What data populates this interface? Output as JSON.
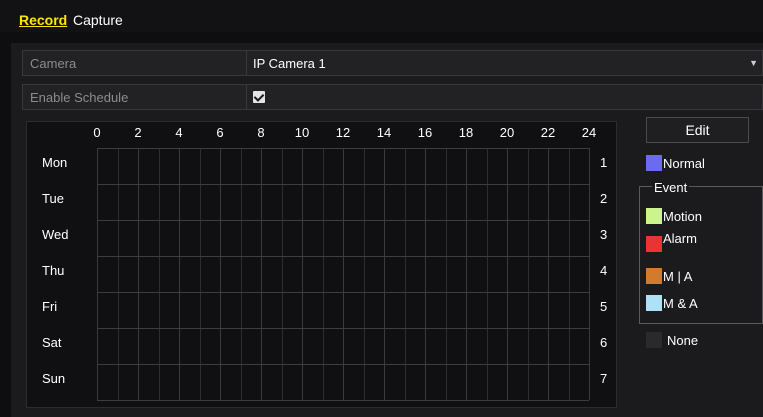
{
  "tabs": {
    "record": "Record",
    "capture": "Capture"
  },
  "camera": {
    "label": "Camera",
    "value": "IP Camera 1"
  },
  "enable_schedule": {
    "label": "Enable Schedule",
    "checked": true
  },
  "schedule": {
    "hours": [
      "0",
      "2",
      "4",
      "6",
      "8",
      "10",
      "12",
      "14",
      "16",
      "18",
      "20",
      "22",
      "24"
    ],
    "days": [
      "Mon",
      "Tue",
      "Wed",
      "Thu",
      "Fri",
      "Sat",
      "Sun"
    ],
    "copy_numbers": [
      "1",
      "2",
      "3",
      "4",
      "5",
      "6",
      "7"
    ]
  },
  "edit_button": "Edit",
  "legend": {
    "normal": {
      "label": "Normal",
      "color": "#6b6bf0"
    },
    "event_title": "Event",
    "motion": {
      "label": "Motion",
      "color": "#ccf48a"
    },
    "alarm": {
      "label": "Alarm",
      "color": "#e83434"
    },
    "m_or_a": {
      "label": "M | A",
      "color": "#d47a2c"
    },
    "m_and_a": {
      "label": "M & A",
      "color": "#aee0f8"
    },
    "none": {
      "label": "None",
      "color": "#2a2a2d"
    }
  }
}
